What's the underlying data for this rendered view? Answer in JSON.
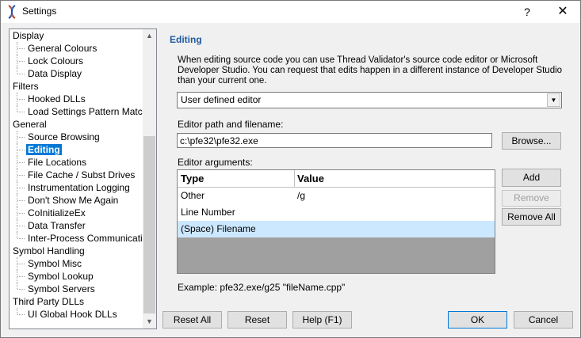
{
  "window": {
    "title": "Settings",
    "help_label": "?",
    "close_label": "✕"
  },
  "tree": {
    "items": [
      {
        "label": "Display",
        "level": 0
      },
      {
        "label": "General Colours",
        "level": 1
      },
      {
        "label": "Lock Colours",
        "level": 1
      },
      {
        "label": "Data Display",
        "level": 1,
        "last": true
      },
      {
        "label": "Filters",
        "level": 0
      },
      {
        "label": "Hooked DLLs",
        "level": 1
      },
      {
        "label": "Load Settings Pattern Match",
        "level": 1,
        "last": true
      },
      {
        "label": "General",
        "level": 0
      },
      {
        "label": "Source Browsing",
        "level": 1
      },
      {
        "label": "Editing",
        "level": 1,
        "selected": true
      },
      {
        "label": "File Locations",
        "level": 1
      },
      {
        "label": "File Cache / Subst Drives",
        "level": 1
      },
      {
        "label": "Instrumentation Logging",
        "level": 1
      },
      {
        "label": "Don't Show Me Again",
        "level": 1
      },
      {
        "label": "CoInitializeEx",
        "level": 1
      },
      {
        "label": "Data Transfer",
        "level": 1
      },
      {
        "label": "Inter-Process Communication",
        "level": 1,
        "last": true
      },
      {
        "label": "Symbol Handling",
        "level": 0
      },
      {
        "label": "Symbol Misc",
        "level": 1
      },
      {
        "label": "Symbol Lookup",
        "level": 1
      },
      {
        "label": "Symbol Servers",
        "level": 1,
        "last": true
      },
      {
        "label": "Third Party DLLs",
        "level": 0
      },
      {
        "label": "UI Global Hook DLLs",
        "level": 1,
        "last": true
      }
    ]
  },
  "editing": {
    "title": "Editing",
    "description": "When editing source code you can use Thread Validator's source code editor or Microsoft Developer Studio. You can request that edits happen in a different instance of Developer Studio than your current one.",
    "editor_type": "User defined editor",
    "path_label": "Editor path and filename:",
    "path_value": "c:\\pfe32\\pfe32.exe",
    "browse_label": "Browse...",
    "args_label": "Editor arguments:",
    "columns": [
      "Type",
      "Value"
    ],
    "rows": [
      {
        "type": "Other",
        "value": "/g"
      },
      {
        "type": "Line Number",
        "value": ""
      },
      {
        "type": "(Space) Filename",
        "value": ""
      }
    ],
    "add_label": "Add",
    "remove_label": "Remove",
    "remove_all_label": "Remove All",
    "example": "Example: pfe32.exe/g25 \"fileName.cpp\""
  },
  "footer": {
    "reset_all": "Reset All",
    "reset": "Reset",
    "help": "Help (F1)",
    "ok": "OK",
    "cancel": "Cancel"
  },
  "colors": {
    "accent": "#0078d7",
    "section_title": "#1f5a9c",
    "row_selected": "#cce8ff"
  }
}
